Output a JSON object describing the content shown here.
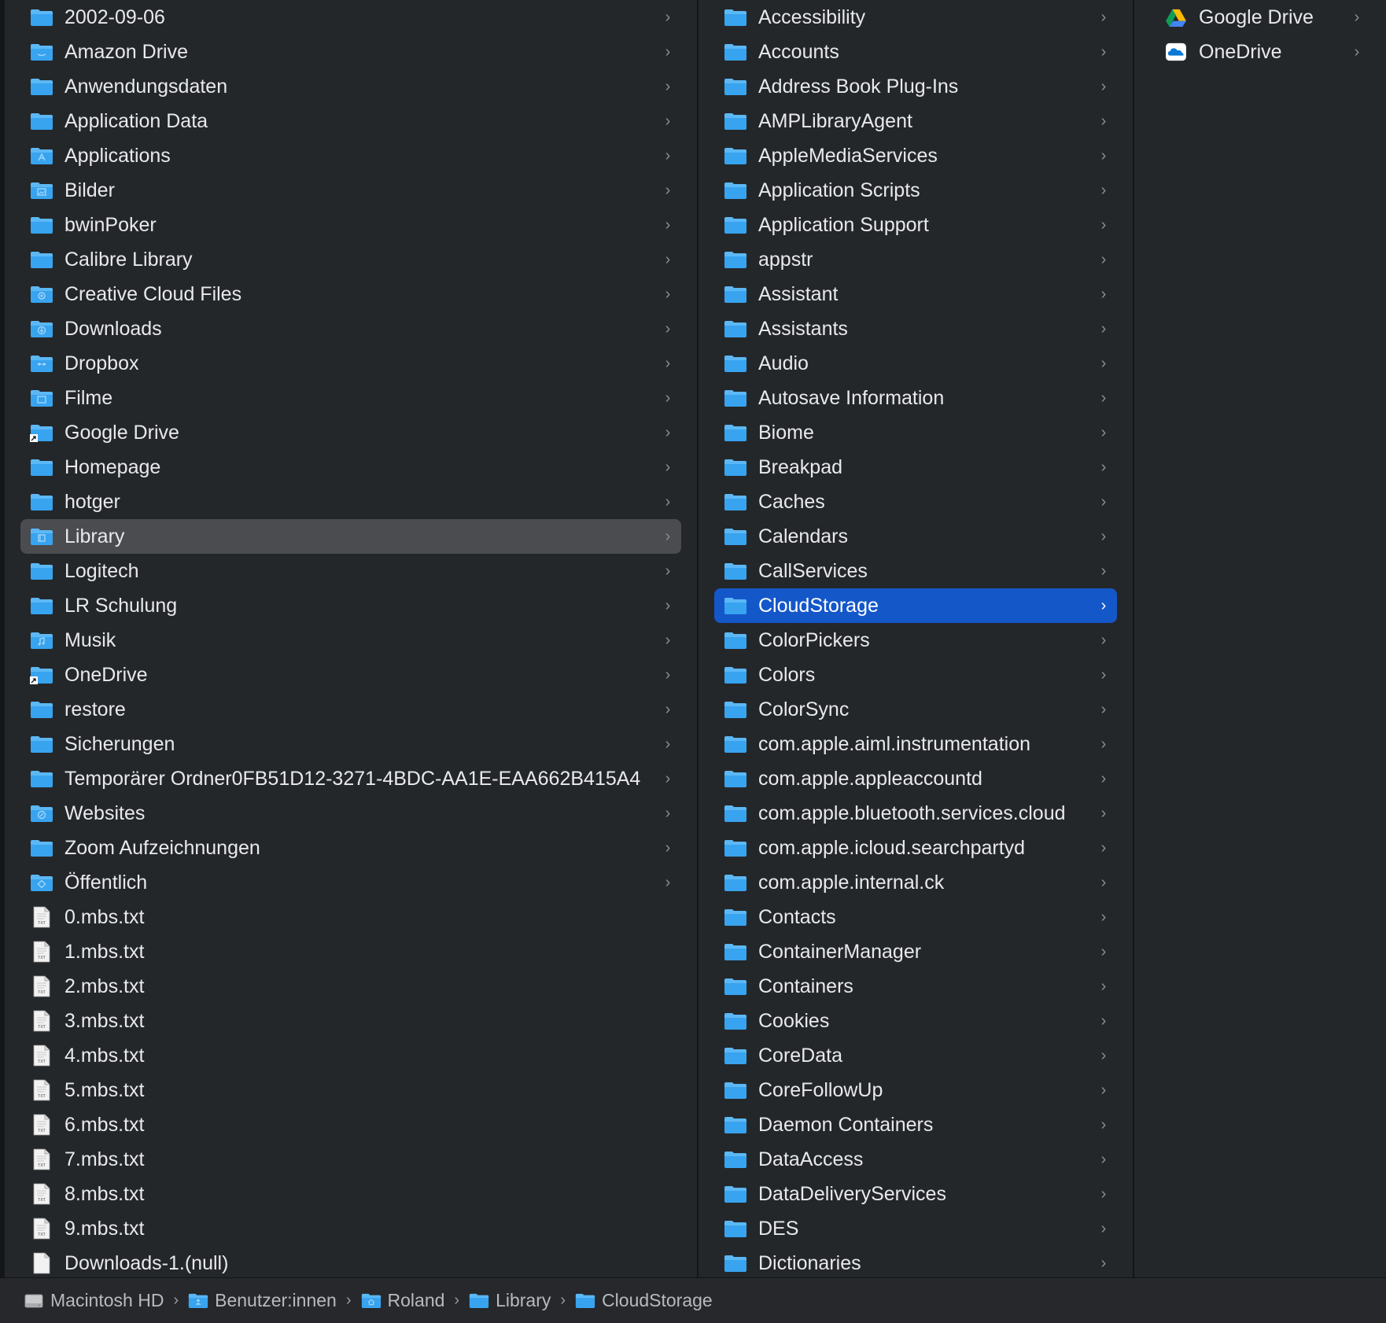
{
  "colors": {
    "folder_blue": "#38a3ef",
    "folder_tab": "#5cb8f5",
    "selection_blue": "#1457c9",
    "selection_gray": "#4a4c50",
    "background": "#24272a"
  },
  "column1": {
    "items": [
      {
        "label": "2002-09-06",
        "icon": "folder-icon",
        "type": "folder"
      },
      {
        "label": "Amazon Drive",
        "icon": "amazon-drive-folder-icon",
        "type": "folder"
      },
      {
        "label": "Anwendungsdaten",
        "icon": "folder-icon",
        "type": "folder"
      },
      {
        "label": "Application Data",
        "icon": "folder-icon",
        "type": "folder"
      },
      {
        "label": "Applications",
        "icon": "applications-folder-icon",
        "type": "folder"
      },
      {
        "label": "Bilder",
        "icon": "pictures-folder-icon",
        "type": "folder"
      },
      {
        "label": "bwinPoker",
        "icon": "folder-icon",
        "type": "folder"
      },
      {
        "label": "Calibre Library",
        "icon": "folder-icon",
        "type": "folder"
      },
      {
        "label": "Creative Cloud Files",
        "icon": "creative-cloud-folder-icon",
        "type": "folder"
      },
      {
        "label": "Downloads",
        "icon": "downloads-folder-icon",
        "type": "folder"
      },
      {
        "label": "Dropbox",
        "icon": "dropbox-folder-icon",
        "type": "folder"
      },
      {
        "label": "Filme",
        "icon": "movies-folder-icon",
        "type": "folder"
      },
      {
        "label": "Google Drive",
        "icon": "alias-folder-icon",
        "type": "folder"
      },
      {
        "label": "Homepage",
        "icon": "folder-icon",
        "type": "folder"
      },
      {
        "label": "hotger",
        "icon": "folder-icon",
        "type": "folder"
      },
      {
        "label": "Library",
        "icon": "library-folder-icon",
        "type": "folder",
        "state": "selected-inactive"
      },
      {
        "label": "Logitech",
        "icon": "folder-icon",
        "type": "folder"
      },
      {
        "label": "LR Schulung",
        "icon": "folder-icon",
        "type": "folder"
      },
      {
        "label": "Musik",
        "icon": "music-folder-icon",
        "type": "folder"
      },
      {
        "label": "OneDrive",
        "icon": "alias-folder-icon",
        "type": "folder"
      },
      {
        "label": "restore",
        "icon": "folder-icon",
        "type": "folder"
      },
      {
        "label": "Sicherungen",
        "icon": "folder-icon",
        "type": "folder"
      },
      {
        "label": "Temporärer Ordner0FB51D12-3271-4BDC-AA1E-EAA662B415A4",
        "icon": "folder-icon",
        "type": "folder"
      },
      {
        "label": "Websites",
        "icon": "sites-folder-icon",
        "type": "folder"
      },
      {
        "label": "Zoom Aufzeichnungen",
        "icon": "folder-icon",
        "type": "folder"
      },
      {
        "label": "Öffentlich",
        "icon": "public-folder-icon",
        "type": "folder"
      },
      {
        "label": "0.mbs.txt",
        "icon": "txt-file-icon",
        "type": "file"
      },
      {
        "label": "1.mbs.txt",
        "icon": "txt-file-icon",
        "type": "file"
      },
      {
        "label": "2.mbs.txt",
        "icon": "txt-file-icon",
        "type": "file"
      },
      {
        "label": "3.mbs.txt",
        "icon": "txt-file-icon",
        "type": "file"
      },
      {
        "label": "4.mbs.txt",
        "icon": "txt-file-icon",
        "type": "file"
      },
      {
        "label": "5.mbs.txt",
        "icon": "txt-file-icon",
        "type": "file"
      },
      {
        "label": "6.mbs.txt",
        "icon": "txt-file-icon",
        "type": "file"
      },
      {
        "label": "7.mbs.txt",
        "icon": "txt-file-icon",
        "type": "file"
      },
      {
        "label": "8.mbs.txt",
        "icon": "txt-file-icon",
        "type": "file"
      },
      {
        "label": "9.mbs.txt",
        "icon": "txt-file-icon",
        "type": "file"
      },
      {
        "label": "Downloads-1.(null)",
        "icon": "blank-file-icon",
        "type": "file"
      }
    ]
  },
  "column2": {
    "items": [
      {
        "label": "Accessibility",
        "icon": "folder-icon",
        "type": "folder"
      },
      {
        "label": "Accounts",
        "icon": "folder-icon",
        "type": "folder"
      },
      {
        "label": "Address Book Plug-Ins",
        "icon": "folder-icon",
        "type": "folder"
      },
      {
        "label": "AMPLibraryAgent",
        "icon": "folder-icon",
        "type": "folder"
      },
      {
        "label": "AppleMediaServices",
        "icon": "folder-icon",
        "type": "folder"
      },
      {
        "label": "Application Scripts",
        "icon": "folder-icon",
        "type": "folder"
      },
      {
        "label": "Application Support",
        "icon": "folder-icon",
        "type": "folder"
      },
      {
        "label": "appstr",
        "icon": "folder-icon",
        "type": "folder"
      },
      {
        "label": "Assistant",
        "icon": "folder-icon",
        "type": "folder"
      },
      {
        "label": "Assistants",
        "icon": "folder-icon",
        "type": "folder"
      },
      {
        "label": "Audio",
        "icon": "folder-icon",
        "type": "folder"
      },
      {
        "label": "Autosave Information",
        "icon": "folder-icon",
        "type": "folder"
      },
      {
        "label": "Biome",
        "icon": "folder-icon",
        "type": "folder"
      },
      {
        "label": "Breakpad",
        "icon": "folder-icon",
        "type": "folder"
      },
      {
        "label": "Caches",
        "icon": "folder-icon",
        "type": "folder"
      },
      {
        "label": "Calendars",
        "icon": "folder-icon",
        "type": "folder"
      },
      {
        "label": "CallServices",
        "icon": "folder-icon",
        "type": "folder"
      },
      {
        "label": "CloudStorage",
        "icon": "folder-icon",
        "type": "folder",
        "state": "selected-active"
      },
      {
        "label": "ColorPickers",
        "icon": "folder-icon",
        "type": "folder"
      },
      {
        "label": "Colors",
        "icon": "folder-icon",
        "type": "folder"
      },
      {
        "label": "ColorSync",
        "icon": "folder-icon",
        "type": "folder"
      },
      {
        "label": "com.apple.aiml.instrumentation",
        "icon": "folder-icon",
        "type": "folder"
      },
      {
        "label": "com.apple.appleaccountd",
        "icon": "folder-icon",
        "type": "folder"
      },
      {
        "label": "com.apple.bluetooth.services.cloud",
        "icon": "folder-icon",
        "type": "folder"
      },
      {
        "label": "com.apple.icloud.searchpartyd",
        "icon": "folder-icon",
        "type": "folder"
      },
      {
        "label": "com.apple.internal.ck",
        "icon": "folder-icon",
        "type": "folder"
      },
      {
        "label": "Contacts",
        "icon": "folder-icon",
        "type": "folder"
      },
      {
        "label": "ContainerManager",
        "icon": "folder-icon",
        "type": "folder"
      },
      {
        "label": "Containers",
        "icon": "folder-icon",
        "type": "folder"
      },
      {
        "label": "Cookies",
        "icon": "folder-icon",
        "type": "folder"
      },
      {
        "label": "CoreData",
        "icon": "folder-icon",
        "type": "folder"
      },
      {
        "label": "CoreFollowUp",
        "icon": "folder-icon",
        "type": "folder"
      },
      {
        "label": "Daemon Containers",
        "icon": "folder-icon",
        "type": "folder"
      },
      {
        "label": "DataAccess",
        "icon": "folder-icon",
        "type": "folder"
      },
      {
        "label": "DataDeliveryServices",
        "icon": "folder-icon",
        "type": "folder"
      },
      {
        "label": "DES",
        "icon": "folder-icon",
        "type": "folder"
      },
      {
        "label": "Dictionaries",
        "icon": "folder-icon",
        "type": "folder"
      }
    ]
  },
  "column3": {
    "items": [
      {
        "label": "Google Drive",
        "icon": "google-drive-icon",
        "type": "folder"
      },
      {
        "label": "OneDrive",
        "icon": "onedrive-icon",
        "type": "folder"
      }
    ]
  },
  "pathbar": {
    "crumbs": [
      {
        "label": "Macintosh HD",
        "icon": "hard-drive-icon"
      },
      {
        "label": "Benutzer:innen",
        "icon": "users-folder-icon"
      },
      {
        "label": "Roland",
        "icon": "home-folder-icon"
      },
      {
        "label": "Library",
        "icon": "folder-icon"
      },
      {
        "label": "CloudStorage",
        "icon": "folder-icon"
      }
    ],
    "separator": "›"
  }
}
